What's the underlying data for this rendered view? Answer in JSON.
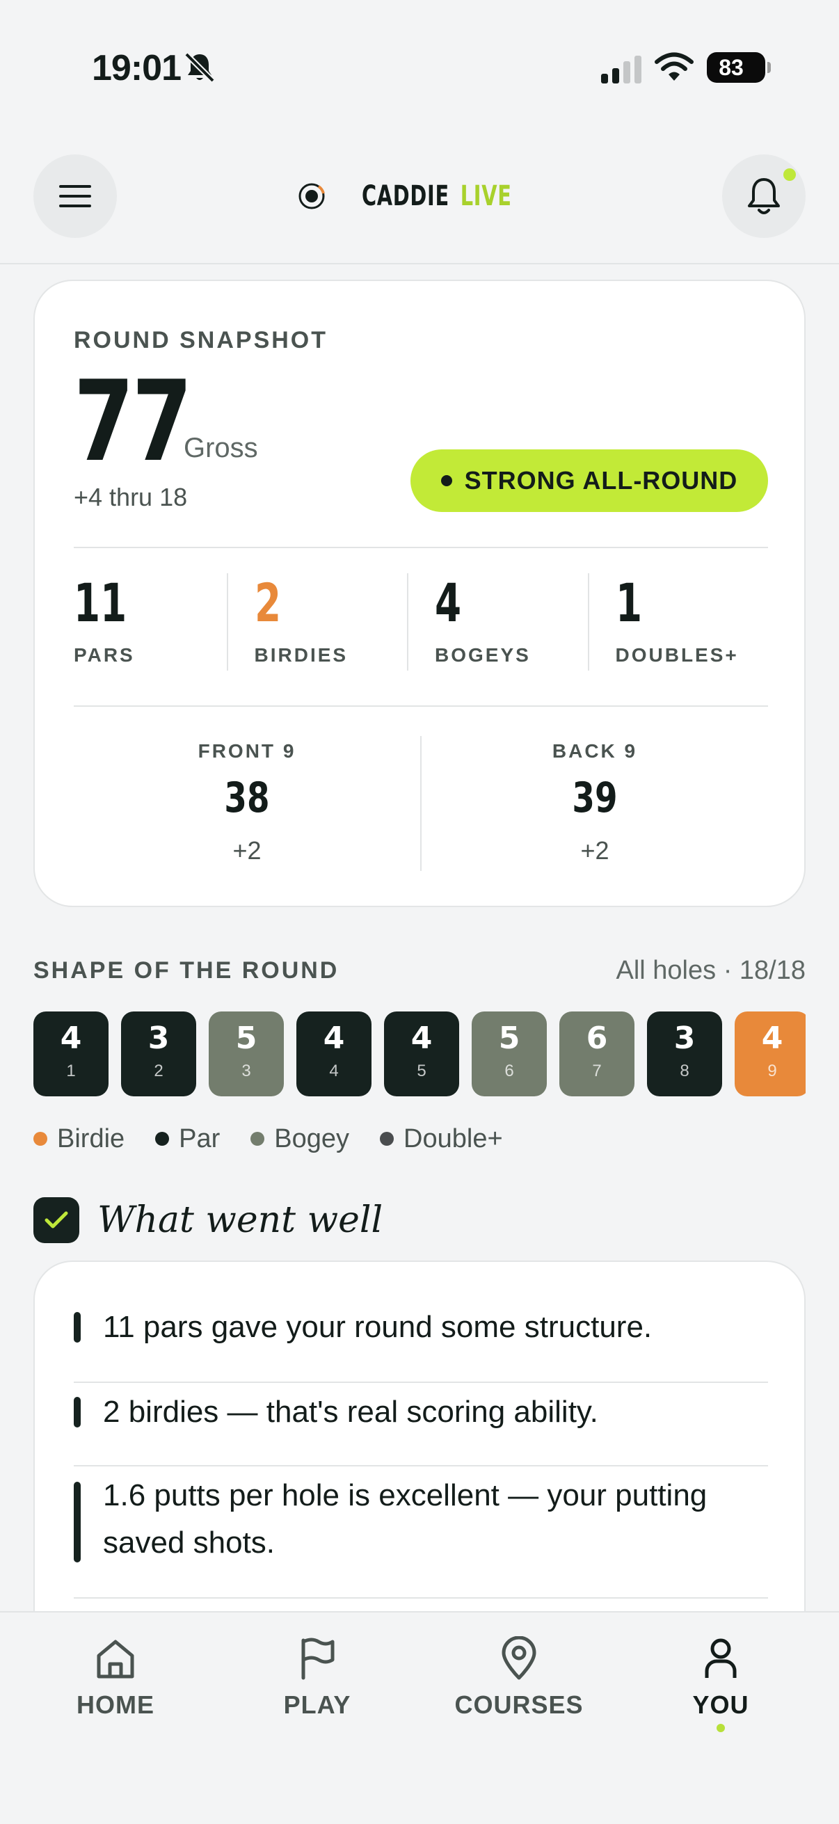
{
  "status_bar": {
    "time": "19:01",
    "battery": "83"
  },
  "header": {
    "logo_primary": "CADDIE",
    "logo_accent": "LIVE"
  },
  "snapshot": {
    "title": "ROUND SNAPSHOT",
    "gross_score": "77",
    "gross_label": "Gross",
    "thru": "+4 thru 18",
    "badge": "STRONG ALL-ROUND",
    "stats": [
      {
        "value": "11",
        "label": "PARS"
      },
      {
        "value": "2",
        "label": "BIRDIES"
      },
      {
        "value": "4",
        "label": "BOGEYS"
      },
      {
        "value": "1",
        "label": "DOUBLES+"
      }
    ],
    "nines": [
      {
        "label": "FRONT 9",
        "score": "38",
        "diff": "+2"
      },
      {
        "label": "BACK 9",
        "score": "39",
        "diff": "+2"
      }
    ]
  },
  "shape": {
    "title": "SHAPE OF THE ROUND",
    "meta": "All holes · 18/18",
    "holes": [
      {
        "score": "4",
        "hole": "1",
        "result": "par"
      },
      {
        "score": "3",
        "hole": "2",
        "result": "par"
      },
      {
        "score": "5",
        "hole": "3",
        "result": "bogey"
      },
      {
        "score": "4",
        "hole": "4",
        "result": "par"
      },
      {
        "score": "4",
        "hole": "5",
        "result": "par"
      },
      {
        "score": "5",
        "hole": "6",
        "result": "bogey"
      },
      {
        "score": "6",
        "hole": "7",
        "result": "bogey"
      },
      {
        "score": "3",
        "hole": "8",
        "result": "par"
      },
      {
        "score": "4",
        "hole": "9",
        "result": "birdie"
      }
    ],
    "legend": [
      {
        "label": "Birdie",
        "color": "#e8893a"
      },
      {
        "label": "Par",
        "color": "#16221f"
      },
      {
        "label": "Bogey",
        "color": "#737d6d"
      },
      {
        "label": "Double+",
        "color": "#4a4d4f"
      }
    ],
    "colors": {
      "par": "#16221f",
      "bogey": "#737d6d",
      "birdie": "#e8893a"
    }
  },
  "went_well": {
    "title": "What went well",
    "items": [
      "11 pars gave your round some structure.",
      "2 birdies — that's real scoring ability.",
      "1.6 putts per hole is excellent — your putting saved shots."
    ]
  },
  "nav": {
    "items": [
      {
        "label": "HOME",
        "icon": "home-icon"
      },
      {
        "label": "PLAY",
        "icon": "flag-icon"
      },
      {
        "label": "COURSES",
        "icon": "map-pin-icon"
      },
      {
        "label": "YOU",
        "icon": "user-icon"
      }
    ],
    "active": "YOU"
  }
}
